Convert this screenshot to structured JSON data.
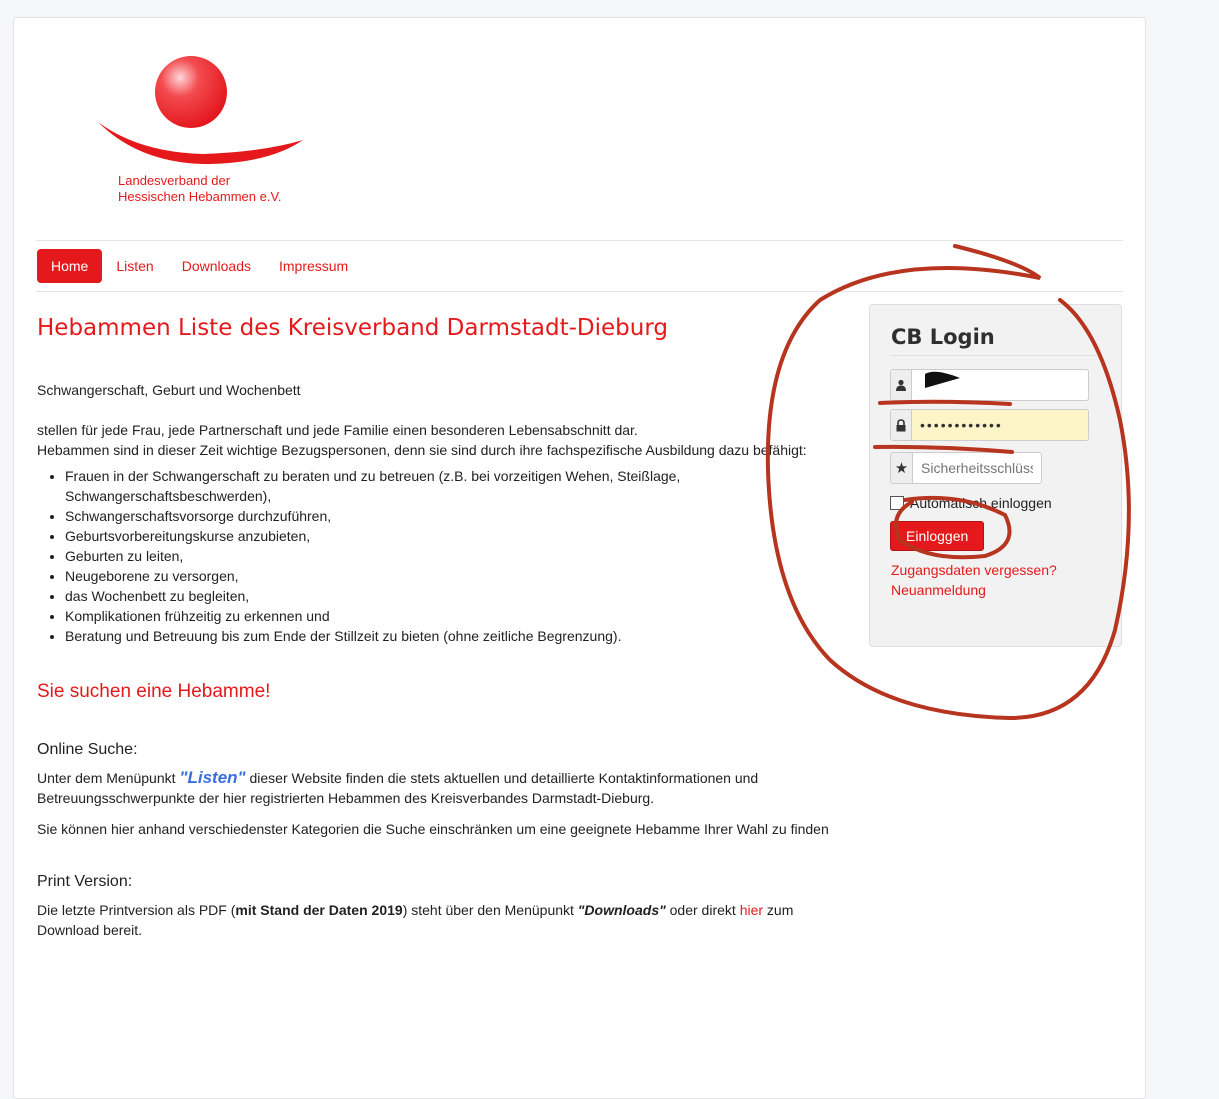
{
  "logo": {
    "line1": "Landesverband der",
    "line2": "Hessischen Hebammen e.V.",
    "colors": {
      "brand": "#e5191b"
    }
  },
  "nav": {
    "items": [
      {
        "label": "Home"
      },
      {
        "label": "Listen"
      },
      {
        "label": "Downloads"
      },
      {
        "label": "Impressum"
      }
    ],
    "active": "Home"
  },
  "main": {
    "title": "Hebammen Liste des Kreisverband Darmstadt-Dieburg",
    "intro": "Schwangerschaft, Geburt und Wochenbett",
    "para_line1": "stellen für jede Frau, jede Partnerschaft und jede Familie einen besonderen Lebensabschnitt dar.",
    "para_line2": "Hebammen sind in dieser Zeit wichtige Bezugspersonen, denn sie sind durch ihre fachspezifische Ausbildung dazu befähigt:",
    "bullets": [
      "Frauen in der Schwangerschaft zu beraten und zu betreuen (z.B. bei vorzeitigen Wehen, Steißlage, Schwangerschaftsbeschwerden),",
      "Schwangerschaftsvorsorge durchzuführen,",
      "Geburtsvorbereitungskurse anzubieten,",
      "Geburten zu leiten,",
      "Neugeborene zu versorgen,",
      "das Wochenbett zu begleiten,",
      "Komplikationen frühzeitig zu erkennen und",
      "Beratung und Betreuung bis zum Ende der Stillzeit zu bieten (ohne zeitliche Begrenzung)."
    ],
    "subtitle": "Sie suchen eine Hebamme!",
    "online": {
      "heading": "Online Suche:",
      "text_before": "Unter dem Menüpunkt ",
      "listen_link": "\"Listen\"",
      "text_after": "  dieser Website finden die stets aktuellen und detaillierte Kontaktinformationen und Betreuungsschwerpunkte der hier registrierten Hebammen des Kreisverbandes Darmstadt-Dieburg.",
      "text2": "Sie können hier anhand verschiedenster Kategorien die Suche einschränken um eine geeignete Hebamme Ihrer Wahl zu finden"
    },
    "print": {
      "heading": "Print Version:",
      "t1": "Die letzte Printversion als PDF (",
      "bold": "mit Stand der Daten 2019",
      "t2": ") steht über den Menüpunkt ",
      "italic_bold": "\"Downloads\"",
      "t3": " oder direkt ",
      "link": "hier",
      "t4": " zum Download bereit."
    }
  },
  "login": {
    "title": "CB Login",
    "password_value": "••••••••••••",
    "key_placeholder": "Sicherheitsschlüssel",
    "remember_label": "Automatisch einloggen",
    "button": "Einloggen",
    "forgot": "Zugangsdaten vergessen?",
    "register": "Neuanmeldung"
  }
}
